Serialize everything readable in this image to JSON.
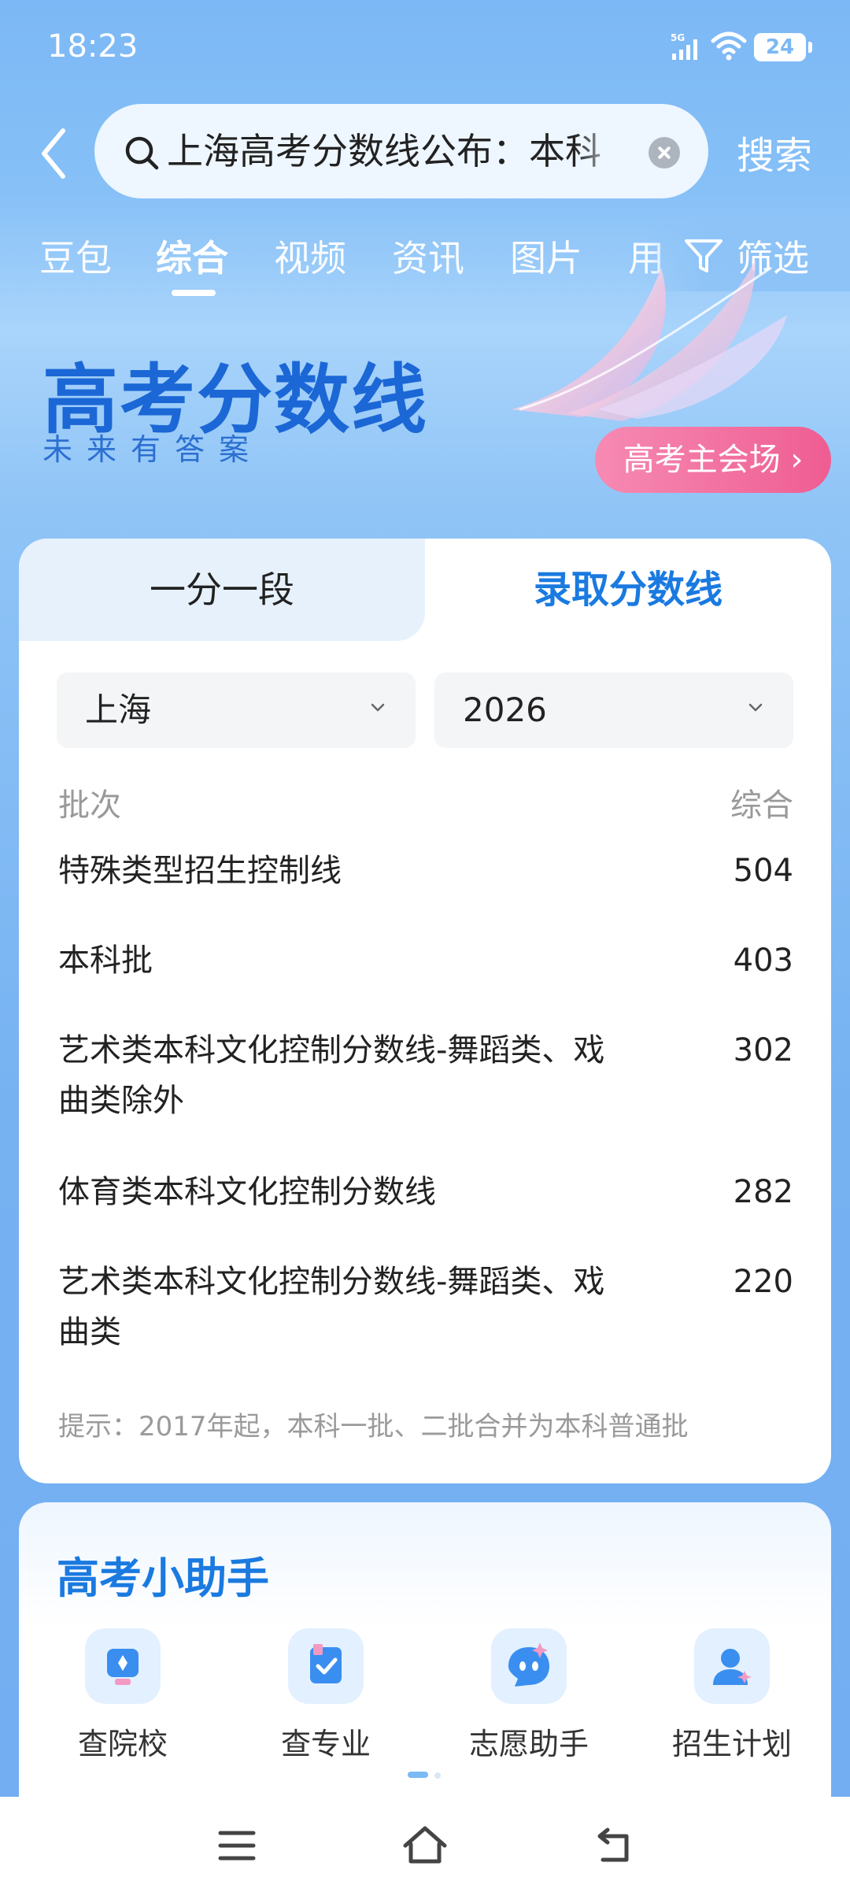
{
  "status_bar": {
    "time": "18:23",
    "network": "5G",
    "battery": "24"
  },
  "search": {
    "query": "上海高考分数线公布：本科",
    "button": "搜索"
  },
  "tabs": [
    "豆包",
    "综合",
    "视频",
    "资讯",
    "图片",
    "用"
  ],
  "active_tab": "综合",
  "filter_label": "筛选",
  "banner": {
    "title": "高考分数线",
    "subtitle": "未来有答案",
    "button": "高考主会场"
  },
  "score_card": {
    "segments": [
      "一分一段",
      "录取分数线"
    ],
    "active_segment": "录取分数线",
    "province": "上海",
    "year": "2026",
    "columns": {
      "batch": "批次",
      "score": "综合"
    },
    "rows": [
      {
        "name": "特殊类型招生控制线",
        "score": "504"
      },
      {
        "name": "本科批",
        "score": "403"
      },
      {
        "name": "艺术类本科文化控制分数线-舞蹈类、戏曲类除外",
        "score": "302"
      },
      {
        "name": "体育类本科文化控制分数线",
        "score": "282"
      },
      {
        "name": "艺术类本科文化控制分数线-舞蹈类、戏曲类",
        "score": "220"
      }
    ],
    "tip": "提示：2017年起，本科一批、二批合并为本科普通批"
  },
  "assistant": {
    "title": "高考小助手",
    "tools": [
      {
        "label": "查院校",
        "icon": "school-icon"
      },
      {
        "label": "查专业",
        "icon": "major-icon"
      },
      {
        "label": "志愿助手",
        "icon": "assistant-icon"
      },
      {
        "label": "招生计划",
        "icon": "plan-icon"
      }
    ]
  },
  "colors": {
    "accent": "#1a7ae0",
    "banner_button": "#ef5d92",
    "background": "#7cb8f5"
  }
}
